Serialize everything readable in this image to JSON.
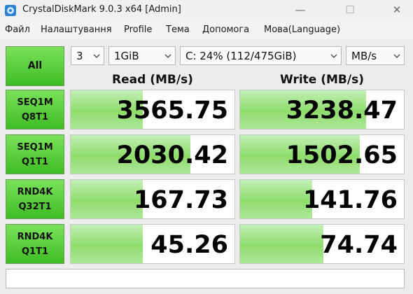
{
  "window": {
    "title": "CrystalDiskMark 9.0.3 x64 [Admin]",
    "icon": "crystaldiskmark-app-icon",
    "controls": {
      "minimize": "—",
      "maximize": "☐",
      "close": "✕"
    }
  },
  "menu": {
    "items": [
      "Файл",
      "Налаштування",
      "Profile",
      "Тема",
      "Допомога",
      "Мова(Language)"
    ]
  },
  "controls": {
    "count": "3",
    "size": "1GiB",
    "drive": "C: 24% (112/475GiB)",
    "unit": "MB/s"
  },
  "headers": {
    "read": "Read (MB/s)",
    "write": "Write (MB/s)"
  },
  "all_button": "All",
  "accent": "#3fbc24",
  "tests": [
    {
      "line1": "SEQ1M",
      "line2": "Q8T1",
      "read": "3565.75",
      "write": "3238.47",
      "read_fill": 0.44,
      "write_fill": 0.77
    },
    {
      "line1": "SEQ1M",
      "line2": "Q1T1",
      "read": "2030.42",
      "write": "1502.65",
      "read_fill": 0.73,
      "write_fill": 0.73
    },
    {
      "line1": "RND4K",
      "line2": "Q32T1",
      "read": "167.73",
      "write": "141.76",
      "read_fill": 0.44,
      "write_fill": 0.44
    },
    {
      "line1": "RND4K",
      "line2": "Q1T1",
      "read": "45.26",
      "write": "74.74",
      "read_fill": 0.44,
      "write_fill": 0.51
    }
  ],
  "comment": ""
}
